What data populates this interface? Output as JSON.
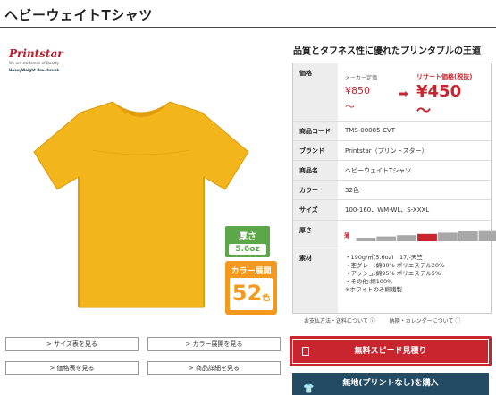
{
  "page_title": "ヘビーウェイトTシャツ",
  "brand": {
    "logo": "Printstar",
    "tagline": "We are craftsmen of Quality",
    "subline": "HeavyWeight Pre-shrunk"
  },
  "badges": {
    "thickness_label": "厚さ",
    "thickness_value": "5.6oz",
    "color_label": "カラー展開",
    "color_count": "52",
    "color_unit": "色"
  },
  "headline": "品質とタフネス性に優れたプリンタブルの王道",
  "spec": {
    "price_key": "価格",
    "maker_label": "メーカー定価",
    "maker_price": "¥850",
    "maker_tilde": "～",
    "arrow": "➡",
    "resale_label": "リサート価格(税抜)",
    "resale_price": "¥450",
    "resale_tilde": "～",
    "code_key": "商品コード",
    "code_val": "TMS-00085-CVT",
    "brand_key": "ブランド",
    "brand_val": "Printstar（プリントスター）",
    "name_key": "商品名",
    "name_val": "ヘビーウェイトTシャツ",
    "color_key": "カラー",
    "color_val": "52色",
    "size_key": "サイズ",
    "size_val": "100-160、WM-WL、S-XXXL",
    "thick_key": "厚さ",
    "thin_label": "薄",
    "thick_label": "厚",
    "thickness_level": 4,
    "thickness_steps": 7,
    "material_key": "素材",
    "material_lines": [
      "・190g/㎡(5.6oz)　17/-天竺",
      "・杢グレー:綿80% ポリエステル20%",
      "・アッシュ:綿95% ポリエステル5%",
      "・その他:綿100%",
      "※ホワイトのみ綿繊製"
    ]
  },
  "info_links": [
    "お支払方法・送料について ⓘ",
    "納期・カレンダーについて ⓘ"
  ],
  "buttons": {
    "size": "> サイズ表を見る",
    "color": "> カラー展開を見る",
    "price": "> 価格表を見る",
    "detail": "> 商品詳細を見る"
  },
  "cta": {
    "quote": "無料スピード見積り",
    "buy": "無地(プリントなし)を購入"
  },
  "colors": {
    "accent_red": "#c9252e",
    "navy": "#234b63",
    "shirt": "#f2b61c",
    "green": "#5ba74a",
    "orange": "#f39a1e"
  }
}
